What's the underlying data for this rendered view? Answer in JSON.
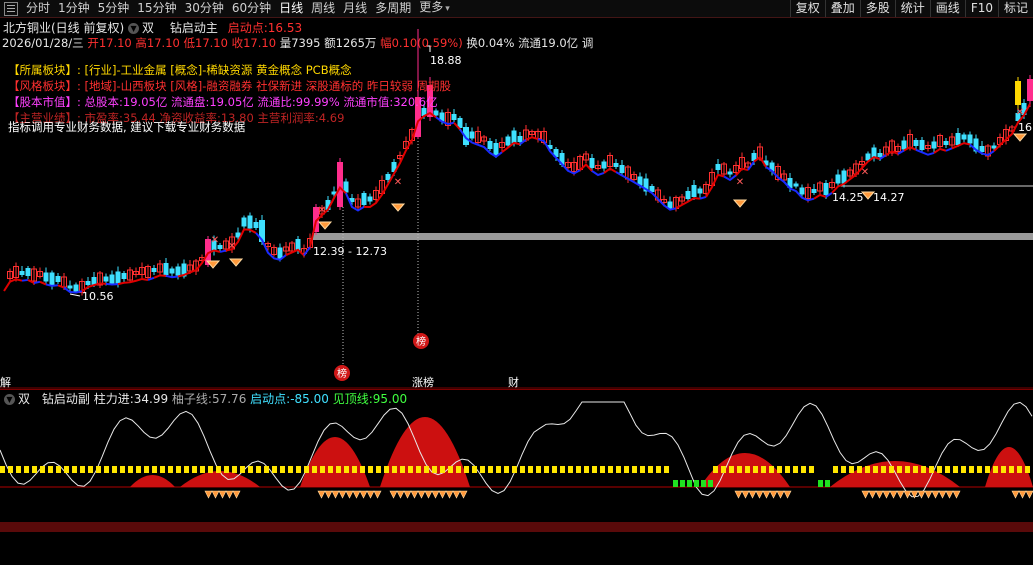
{
  "toolbar": {
    "tabs": [
      {
        "label": "分时",
        "active": false,
        "drop": false
      },
      {
        "label": "1分钟",
        "active": false,
        "drop": false
      },
      {
        "label": "5分钟",
        "active": false,
        "drop": false
      },
      {
        "label": "15分钟",
        "active": false,
        "drop": false
      },
      {
        "label": "30分钟",
        "active": false,
        "drop": false
      },
      {
        "label": "60分钟",
        "active": false,
        "drop": false
      },
      {
        "label": "日线",
        "active": true,
        "drop": false
      },
      {
        "label": "周线",
        "active": false,
        "drop": false
      },
      {
        "label": "月线",
        "active": false,
        "drop": false
      },
      {
        "label": "多周期",
        "active": false,
        "drop": false
      },
      {
        "label": "更多",
        "active": false,
        "drop": true
      }
    ],
    "right_buttons": [
      "复权",
      "叠加",
      "多股",
      "统计",
      "画线",
      "F10",
      "标记"
    ]
  },
  "header": {
    "stock_title": "北方铜业(日线 前复权)",
    "mode": "双",
    "indicator_name": "钻启动主",
    "start_point_label": "启动点:",
    "start_point_value": "16.53"
  },
  "quote": {
    "date": "2026/01/28/三",
    "open_label": "开",
    "open": "17.10",
    "high_label": "高",
    "high": "17.10",
    "low_label": "低",
    "low": "17.10",
    "close_label": "收",
    "close": "17.10",
    "vol_label": "量",
    "vol": "7395",
    "amt_label": "额",
    "amt": "1265万",
    "chg_label": "幅",
    "chg": "0.10(0.59%)",
    "turnover": "换0.04%",
    "float_cap": "流通19.0亿",
    "adjust": "调"
  },
  "panels": {
    "sector_label": "【所属板块】:",
    "sector_value": "[行业]-工业金属 [概念]-稀缺资源 黄金概念 PCB概念",
    "style_label": "【风格板块】:",
    "style_value": "[地域]-山西板块 [风格]-融资融券 社保新进 深股通标的 昨日较弱 周期股",
    "cap_label": "【股本市值】:",
    "cap_value": "总股本:19.05亿 流通盘:19.05亿 流通比:99.99% 流通市值:320.6亿",
    "biz_label": "【主营业绩】:",
    "biz_value": "市盈率:35.44 净资收益率:13.80 主营利润率:4.69",
    "finance_note": "指标调用专业财务数据, 建议下载专业财务数据"
  },
  "price_labels": {
    "high_mark": "18.88",
    "low_mark": "10.56",
    "range_mark": "12.39 - 12.73",
    "right_low_a": "14.25",
    "right_low_b": "14.27",
    "right_edge": "16"
  },
  "markers": {
    "bang": "榜",
    "bang2": "榜",
    "zhangbang": "涨榜",
    "cai": "财",
    "left_edge": "解"
  },
  "sub_indicator": {
    "mode": "双",
    "name": "钻启动副",
    "force_label": "柱力进:",
    "force_value": "34.99",
    "rope_label": "柚子线:",
    "rope_value": "57.76",
    "start_label": "启动点:",
    "start_value": "-85.00",
    "top_label": "见顶线:",
    "top_value": "95.00"
  },
  "colors": {
    "up": "#ff3030",
    "down": "#3ee0ff",
    "ma_red": "#e00000",
    "ma_blue": "#1a2bff",
    "gray_band": "#9a9a9a",
    "yellow_dash": "#ffe600",
    "green_dash": "#20e020"
  }
}
